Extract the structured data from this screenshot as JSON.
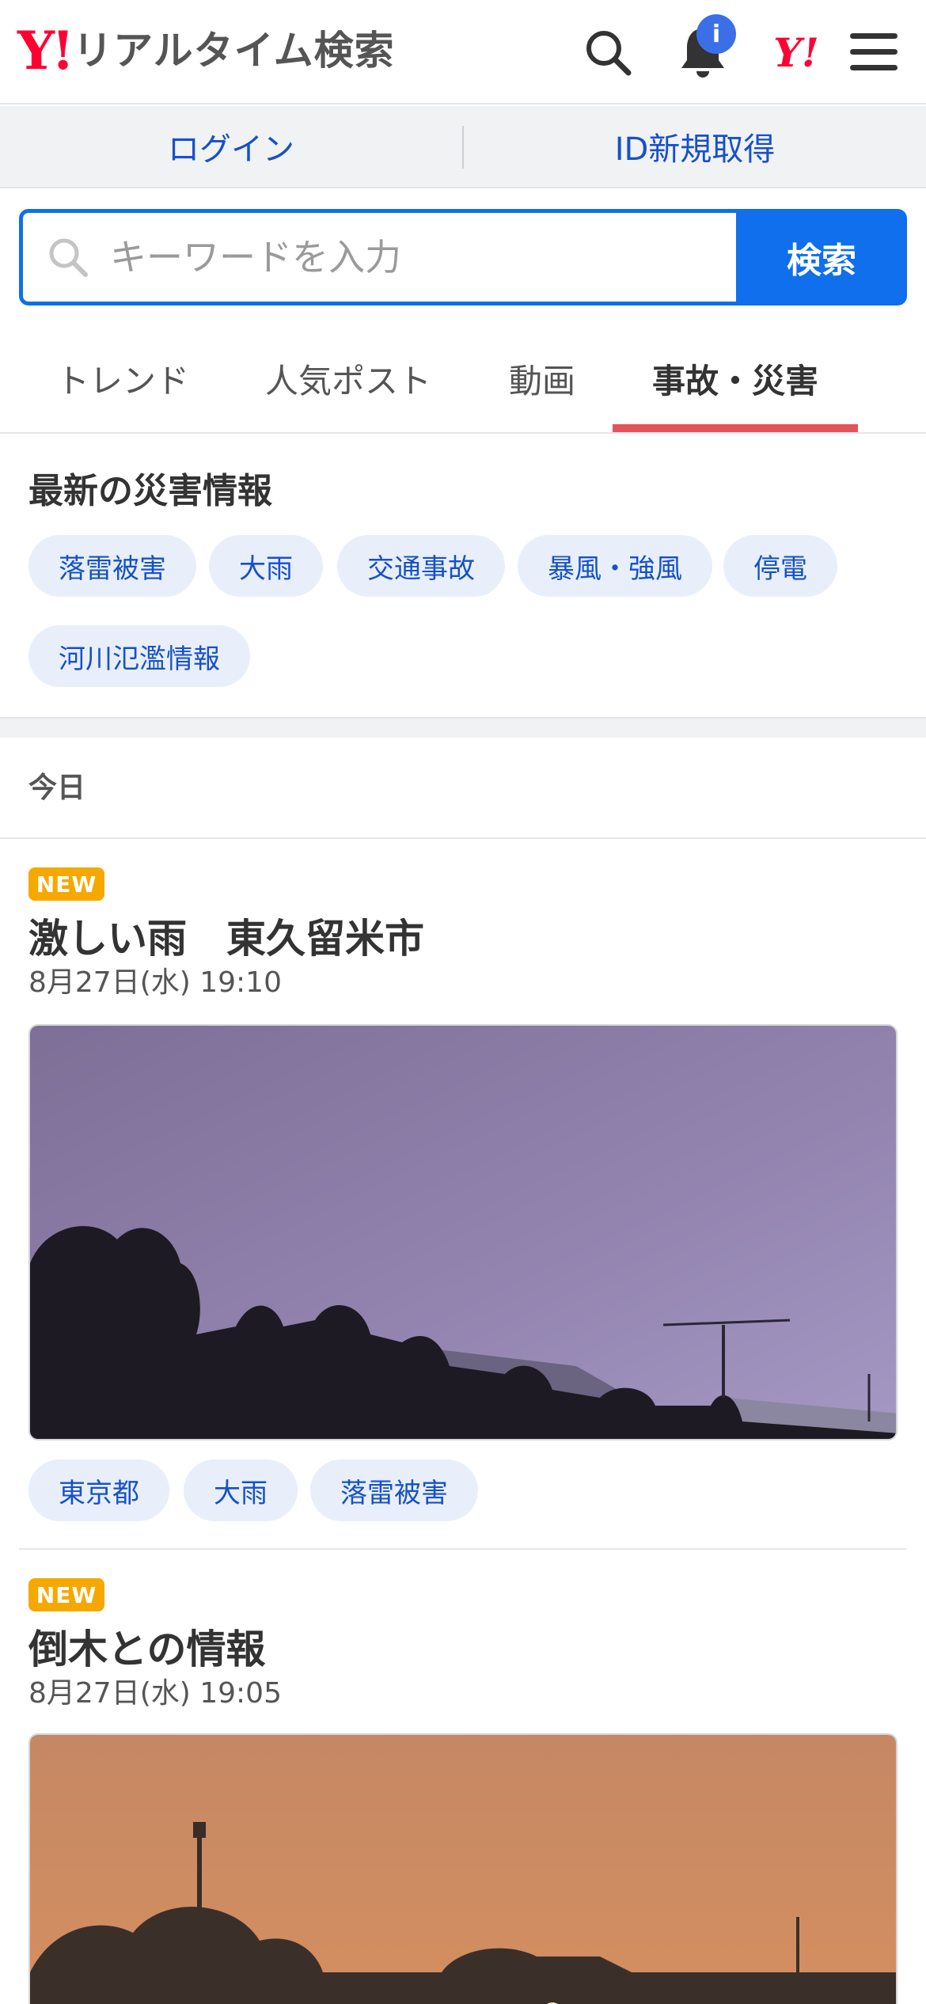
{
  "header": {
    "logo_mark": "Y!",
    "logo_text": "リアルタイム検索",
    "notification_badge": "i",
    "yahoo_mark": "Y!"
  },
  "login_bar": {
    "login_label": "ログイン",
    "register_label": "ID新規取得"
  },
  "search": {
    "placeholder": "キーワードを入力",
    "button_label": "検索"
  },
  "tabs": [
    {
      "label": "トレンド",
      "active": false
    },
    {
      "label": "人気ポスト",
      "active": false
    },
    {
      "label": "動画",
      "active": false
    },
    {
      "label": "事故・災害",
      "active": true
    }
  ],
  "accent_colors": {
    "brand_red": "#ff0033",
    "link_blue": "#1751c7",
    "search_blue": "#0f6fec",
    "tab_underline": "#e3535a",
    "new_badge": "#f5a800"
  },
  "disaster_section": {
    "title": "最新の災害情報",
    "chips": [
      "落雷被害",
      "大雨",
      "交通事故",
      "暴風・強風",
      "停電",
      "河川氾濫情報"
    ]
  },
  "feed": {
    "day_label": "今日",
    "posts": [
      {
        "badge": "NEW",
        "title": "激しい雨　東久留米市",
        "time": "8月27日(水) 19:10",
        "tags": [
          "東京都",
          "大雨",
          "落雷被害"
        ]
      },
      {
        "badge": "NEW",
        "title": "倒木との情報",
        "time": "8月27日(水) 19:05",
        "tags": []
      }
    ]
  }
}
